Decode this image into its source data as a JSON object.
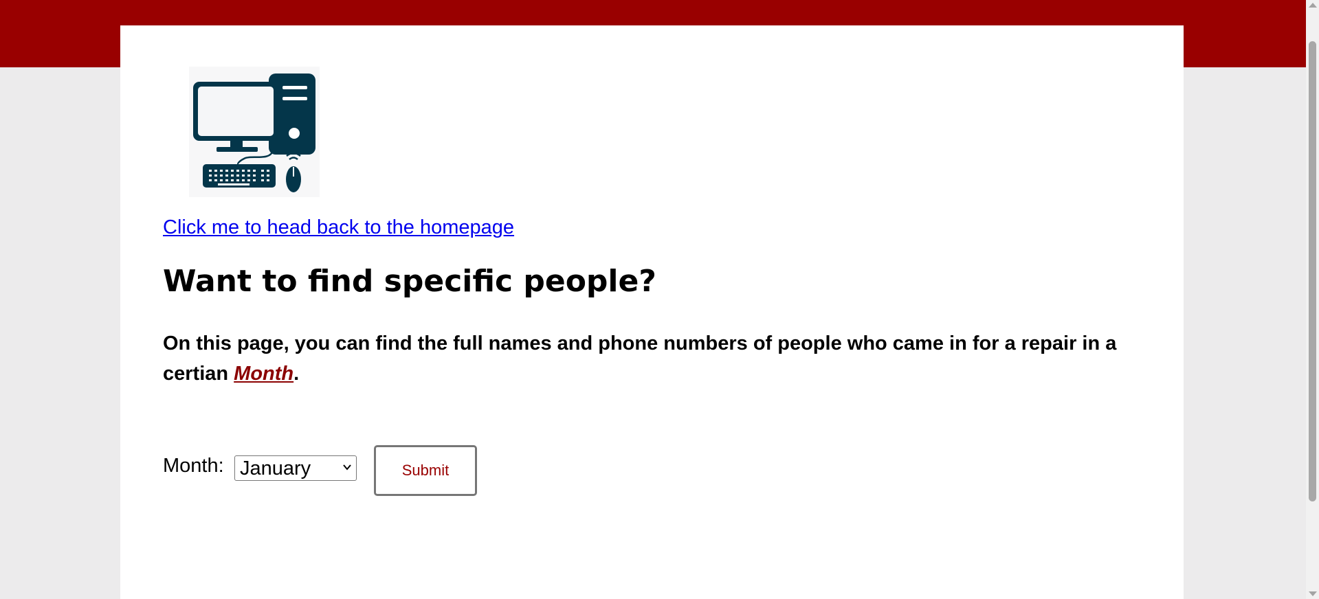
{
  "colors": {
    "brand_red": "#990000",
    "page_background": "#ecebec",
    "link_blue": "#0000ee",
    "icon_navy": "#04364a"
  },
  "logo": {
    "icon": "desktop-computer-icon"
  },
  "nav": {
    "home_link_label": "Click me to head back to the homepage"
  },
  "main": {
    "title": "Want to find specific people?",
    "description_prefix": "On this page, you can find the full names and phone numbers of people who came in for a repair in a certian ",
    "description_emphasis": "Month",
    "description_suffix": "."
  },
  "form": {
    "month_label": "Month:",
    "month_selected": "January",
    "submit_label": "Submit"
  }
}
